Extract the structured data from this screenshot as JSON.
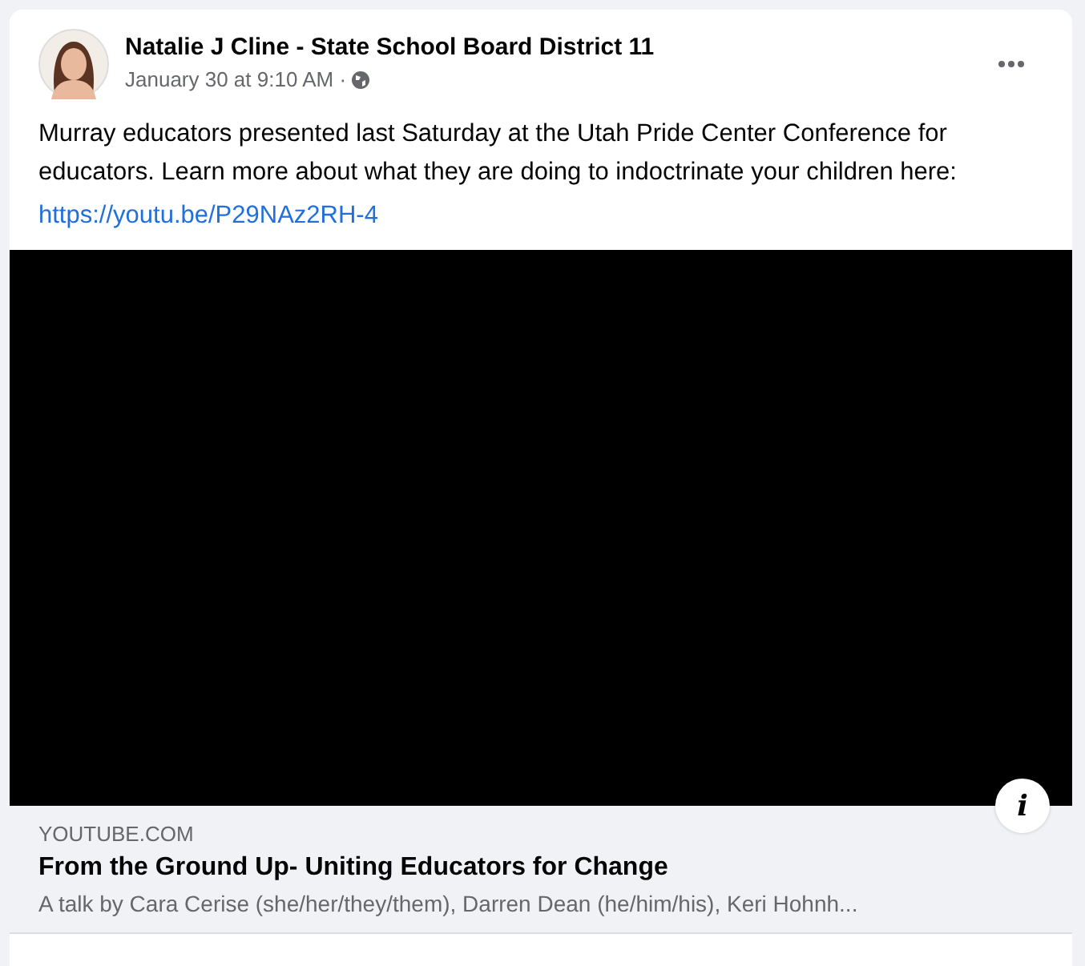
{
  "post": {
    "author": "Natalie J Cline - State School Board District 11",
    "timestamp": "January 30 at 9:10 AM ·",
    "text": "Murray educators presented last Saturday at the Utah Pride Center Conference for educators. Learn more about what they are doing to indoctrinate your children here:",
    "link": "https://youtu.be/P29NAz2RH-4"
  },
  "link_preview": {
    "domain": "YOUTUBE.COM",
    "title": "From the Ground Up- Uniting Educators for Change",
    "description": "A talk by Cara Cerise (she/her/they/them), Darren Dean (he/him/his), Keri Hohnh...",
    "info_glyph": "i"
  }
}
